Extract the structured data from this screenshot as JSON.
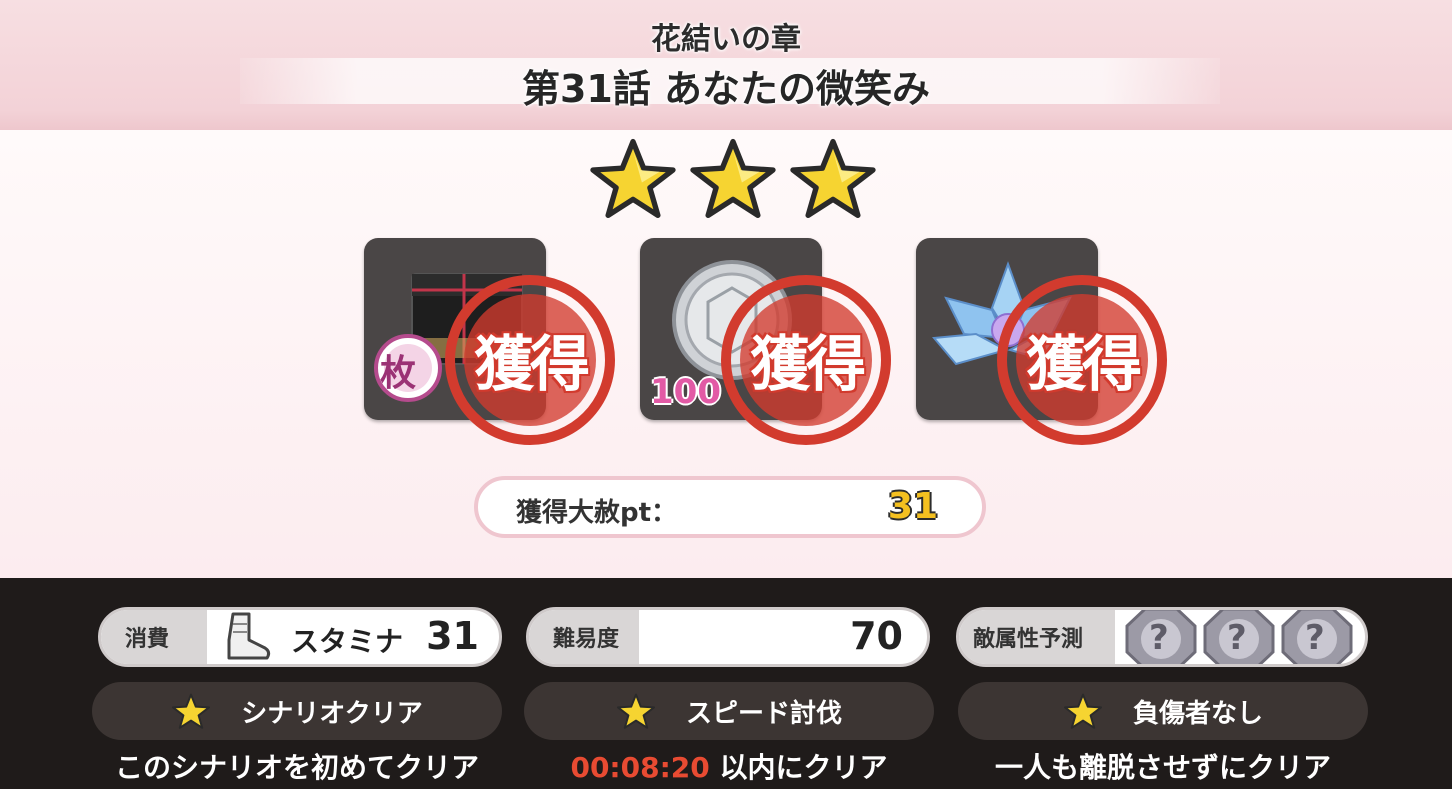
{
  "header": {
    "chapter": "花結いの章",
    "episode": "第31話 あなたの微笑み"
  },
  "rating": {
    "stars_earned": 3,
    "stars_total": 3
  },
  "rewards": [
    {
      "item": "gift-box-item",
      "quantity_visible": "",
      "badge": "枚",
      "stamp": "獲得"
    },
    {
      "item": "silver-coin-item",
      "quantity_visible": "100",
      "stamp": "獲得"
    },
    {
      "item": "blue-lotus-crystal-item",
      "quantity_visible": "",
      "stamp": "獲得"
    }
  ],
  "points": {
    "label": "獲得大赦pt：",
    "value": "31"
  },
  "info": {
    "consume_label": "消費",
    "stamina_label": "スタミナ",
    "stamina_value": "31",
    "difficulty_label": "難易度",
    "difficulty_value": "70",
    "enemy_label": "敵属性予測",
    "enemy_unknown": "?"
  },
  "conditions": [
    {
      "label": "シナリオクリア",
      "desc": "このシナリオを初めてクリア"
    },
    {
      "label": "スピード討伐",
      "time": "00:08:20",
      "desc": "以内にクリア"
    },
    {
      "label": "負傷者なし",
      "desc": "一人も離脱させずにクリア"
    }
  ],
  "colors": {
    "header_pink": "#f3d2d7",
    "stamp_red": "#d23b2e",
    "star_yellow": "#f6d431",
    "points_yellow": "#f4c020",
    "time_red": "#e84b32"
  }
}
